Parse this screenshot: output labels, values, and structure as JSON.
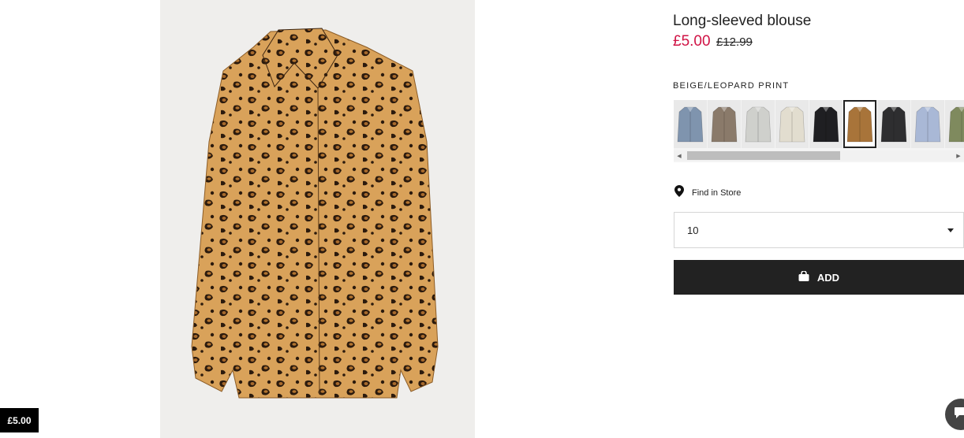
{
  "product": {
    "title": "Long-sleeved blouse",
    "price_sale": "£5.00",
    "price_original": "£12.99",
    "color_name": "BEIGE/LEOPARD PRINT",
    "image_icon": "leopard-print-blouse-image",
    "accent_sale_color": "#d01345"
  },
  "badge": {
    "price": "£5.00"
  },
  "swatches": [
    {
      "name": "blue-stripe",
      "color": "#7f94ae",
      "selected": false
    },
    {
      "name": "snake-print",
      "color": "#8a7a6a",
      "selected": false
    },
    {
      "name": "grey-print",
      "color": "#cfd0cc",
      "selected": false
    },
    {
      "name": "cream-floral",
      "color": "#e2ddcf",
      "selected": false
    },
    {
      "name": "black",
      "color": "#1f1f22",
      "selected": false
    },
    {
      "name": "leopard",
      "color": "#a8743a",
      "selected": true
    },
    {
      "name": "black-stripe",
      "color": "#2e2e30",
      "selected": false
    },
    {
      "name": "light-blue",
      "color": "#a9b8d6",
      "selected": false
    },
    {
      "name": "khaki",
      "color": "#7f8a5e",
      "selected": false
    }
  ],
  "store": {
    "label": "Find in Store",
    "icon": "location-pin-icon"
  },
  "size": {
    "selected": "10"
  },
  "cart": {
    "label": "ADD",
    "icon": "shopping-bag-icon"
  },
  "chat": {
    "icon": "chat-icon"
  }
}
